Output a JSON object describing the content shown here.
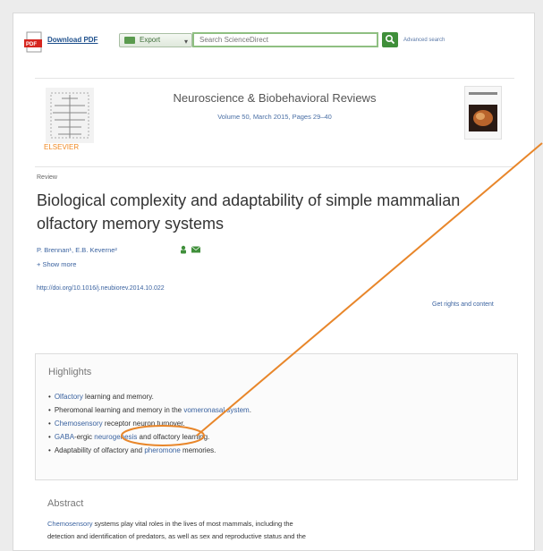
{
  "toolbar": {
    "download_pdf": "Download PDF",
    "export_label": "Export",
    "search_placeholder": "Search ScienceDirect",
    "advanced_search": "Advanced search"
  },
  "journal": {
    "name": "Neuroscience & Biobehavioral Reviews",
    "meta": "Volume 50, March 2015, Pages 29–40",
    "publisher": "ELSEVIER"
  },
  "article": {
    "type": "Review",
    "title_line1": "Biological complexity and adaptability of simple mammalian",
    "title_line2": "olfactory memory systems",
    "authors": "P. Brennan¹, E.B. Keverne²",
    "show_more": "+ Show more",
    "doi": "http://doi.org/10.1016/j.neubiorev.2014.10.022",
    "rights": "Get rights and content"
  },
  "highlights": {
    "title": "Highlights",
    "items": [
      {
        "a": "",
        "link": "Olfactory",
        "b": " learning and memory.",
        "link2": "",
        "c": ""
      },
      {
        "a": "Pheromonal learning and memory in the ",
        "link": "vomeronasal system",
        "b": ".",
        "link2": "",
        "c": ""
      },
      {
        "a": "",
        "link": "Chemosensory",
        "b": " receptor neuron turnover.",
        "link2": "",
        "c": ""
      },
      {
        "a": "",
        "link": "GABA",
        "b": "-ergic ",
        "link2": "neurogenesis",
        "c": " and olfactory learning."
      },
      {
        "a": "Adaptability of olfactory and ",
        "link": "pheromone",
        "b": " memories.",
        "link2": "",
        "c": ""
      }
    ]
  },
  "abstract": {
    "title": "Abstract",
    "line1_link": "Chemosensory",
    "line1_rest": " systems play vital roles in the lives of most mammals, including the",
    "line2": "detection and identification of predators, as well as sex and reproductive status and the"
  },
  "colors": {
    "annotation": "#e8862a",
    "link": "#3b63a0",
    "accent_green": "#3f8f3a"
  }
}
